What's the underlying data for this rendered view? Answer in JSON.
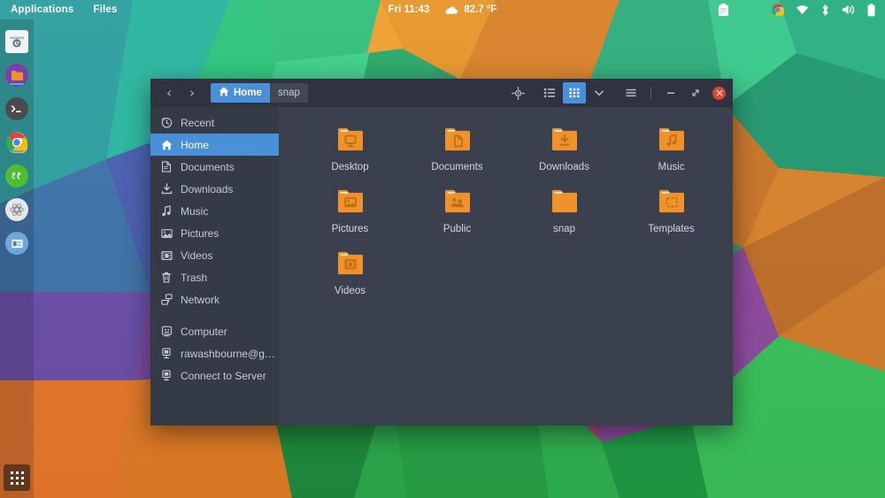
{
  "topbar": {
    "applications_label": "Applications",
    "files_label": "Files",
    "clock": "Fri 11:43",
    "weather_temp": "82.7 °F",
    "weather_icon": "cloud-icon",
    "right_icons": [
      {
        "name": "clipboard-icon"
      },
      {
        "name": "chrome-icon"
      },
      {
        "name": "wifi-icon"
      },
      {
        "name": "bluetooth-icon"
      },
      {
        "name": "volume-icon"
      },
      {
        "name": "battery-icon"
      }
    ]
  },
  "dock": {
    "items": [
      {
        "name": "software-updater-icon",
        "label": "Software Updater",
        "running": false
      },
      {
        "name": "files-icon",
        "label": "Files",
        "running": true
      },
      {
        "name": "terminal-icon",
        "label": "Terminal",
        "running": false
      },
      {
        "name": "chrome-icon",
        "label": "Google Chrome",
        "running": true
      },
      {
        "name": "messaging-icon",
        "label": "Messaging",
        "running": false
      },
      {
        "name": "settings-icon",
        "label": "Settings",
        "running": false
      },
      {
        "name": "libreoffice-impress-icon",
        "label": "LibreOffice Impress",
        "running": true
      }
    ],
    "apps_button_label": "Show Applications"
  },
  "window": {
    "title": "Home",
    "nav": {
      "back": "‹",
      "forward": "›"
    },
    "breadcrumbs": [
      {
        "label": "Home",
        "icon": "home-icon",
        "active": true
      },
      {
        "label": "snap",
        "icon": "",
        "active": false
      }
    ],
    "toolbar": [
      {
        "name": "search-location-icon",
        "label": "Search",
        "active": false
      },
      {
        "name": "list-view-icon",
        "label": "List view",
        "active": false
      },
      {
        "name": "grid-view-icon",
        "label": "Grid view",
        "active": true
      },
      {
        "name": "chevron-down-icon",
        "label": "View options",
        "active": false
      },
      {
        "name": "hamburger-menu-icon",
        "label": "Menu",
        "active": false
      }
    ],
    "controls": [
      {
        "name": "minimize-button",
        "label": "–"
      },
      {
        "name": "maximize-button",
        "label": "Restore"
      },
      {
        "name": "close-button",
        "label": "×"
      }
    ],
    "sidebar": {
      "groups": [
        {
          "items": [
            {
              "label": "Recent",
              "icon": "clock-icon",
              "selected": false
            },
            {
              "label": "Home",
              "icon": "home-icon",
              "selected": true
            },
            {
              "label": "Documents",
              "icon": "document-icon",
              "selected": false
            },
            {
              "label": "Downloads",
              "icon": "download-icon",
              "selected": false
            },
            {
              "label": "Music",
              "icon": "music-note-icon",
              "selected": false
            },
            {
              "label": "Pictures",
              "icon": "image-icon",
              "selected": false
            },
            {
              "label": "Videos",
              "icon": "film-icon",
              "selected": false
            },
            {
              "label": "Trash",
              "icon": "trash-icon",
              "selected": false
            },
            {
              "label": "Network",
              "icon": "network-icon",
              "selected": false
            }
          ]
        },
        {
          "items": [
            {
              "label": "Computer",
              "icon": "computer-icon",
              "selected": false
            },
            {
              "label": "rawashbourne@g…",
              "icon": "server-icon",
              "selected": false
            },
            {
              "label": "Connect to Server",
              "icon": "server-icon",
              "selected": false
            }
          ]
        }
      ]
    },
    "files": [
      {
        "name": "Desktop",
        "icon": "folder-desktop-icon"
      },
      {
        "name": "Documents",
        "icon": "folder-documents-icon"
      },
      {
        "name": "Downloads",
        "icon": "folder-downloads-icon"
      },
      {
        "name": "Music",
        "icon": "folder-music-icon"
      },
      {
        "name": "Pictures",
        "icon": "folder-pictures-icon"
      },
      {
        "name": "Public",
        "icon": "folder-public-icon"
      },
      {
        "name": "snap",
        "icon": "folder-plain-icon"
      },
      {
        "name": "Templates",
        "icon": "folder-templates-icon"
      },
      {
        "name": "Videos",
        "icon": "folder-videos-icon"
      }
    ]
  },
  "colors": {
    "accent": "#4a90d9",
    "window_bg": "#3b404e",
    "sidebar_bg": "#353a47",
    "header_bg": "#2f333f",
    "folder_orange": "#f0922b",
    "close_red": "#d64937"
  }
}
